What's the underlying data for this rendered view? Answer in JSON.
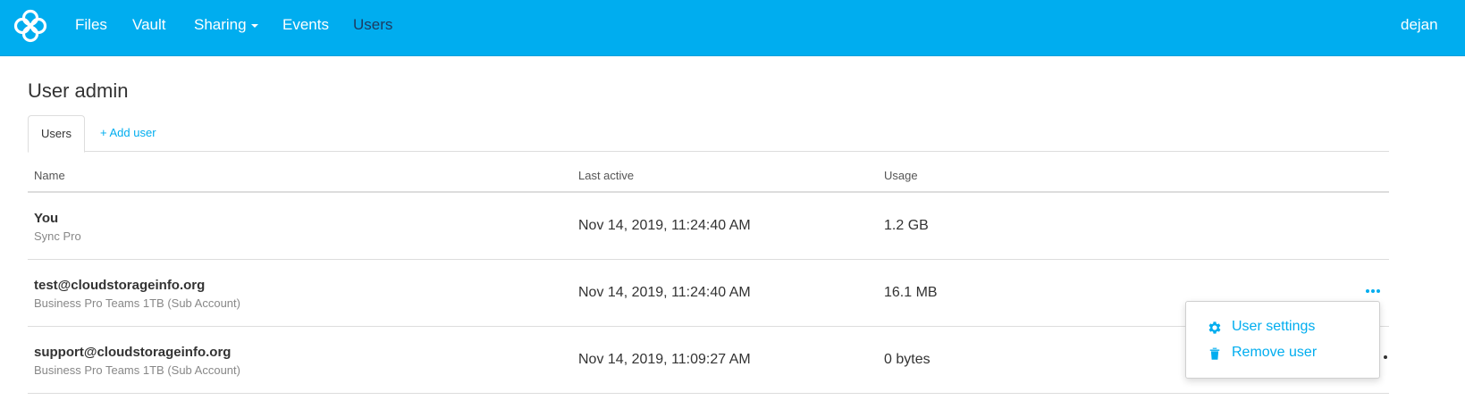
{
  "nav": {
    "logo_icon": "sync-logo-icon",
    "items": [
      {
        "label": "Files"
      },
      {
        "label": "Vault"
      },
      {
        "label": "Sharing",
        "has_dropdown": true
      },
      {
        "label": "Events"
      },
      {
        "label": "Users",
        "active": true
      }
    ],
    "user": "dejan"
  },
  "page": {
    "title": "User admin"
  },
  "tabs": {
    "users": "Users",
    "add_user": "+ Add user"
  },
  "table": {
    "headers": {
      "name": "Name",
      "last_active": "Last active",
      "usage": "Usage"
    },
    "rows": [
      {
        "name": "You",
        "plan": "Sync Pro",
        "last_active": "Nov 14, 2019, 11:24:40 AM",
        "usage": "1.2 GB"
      },
      {
        "name": "test@cloudstorageinfo.org",
        "plan": "Business Pro Teams 1TB (Sub Account)",
        "last_active": "Nov 14, 2019, 11:24:40 AM",
        "usage": "16.1 MB"
      },
      {
        "name": "support@cloudstorageinfo.org",
        "plan": "Business Pro Teams 1TB (Sub Account)",
        "last_active": "Nov 14, 2019, 11:09:27 AM",
        "usage": "0 bytes"
      }
    ]
  },
  "dropdown": {
    "settings_label": "User settings",
    "settings_icon": "gear-icon",
    "remove_label": "Remove user",
    "remove_icon": "trash-icon"
  },
  "colors": {
    "brand": "#00adef",
    "active_nav": "#1e3a5f"
  }
}
